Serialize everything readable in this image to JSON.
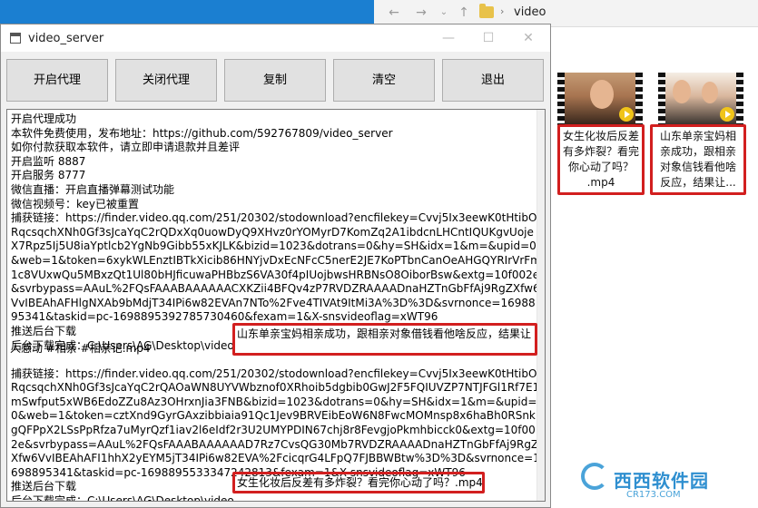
{
  "explorer": {
    "back_icon": "←",
    "forward_icon": "→",
    "dropdown_icon": "⌄",
    "up_icon": "↑",
    "path_separator": "›",
    "path": "video"
  },
  "thumbnails": [
    {
      "icon": "video-thumbnail-icon"
    },
    {
      "icon": "video-thumbnail-icon"
    }
  ],
  "files": [
    {
      "lines": [
        "女生化妆后反差",
        "有多炸裂？看完",
        "你心动了吗？",
        ".mp4"
      ]
    },
    {
      "lines": [
        "山东单亲宝妈相",
        "亲成功，跟相亲",
        "对象信钱看他啥",
        "反应，结果让..."
      ]
    }
  ],
  "window": {
    "title": "video_server",
    "minimize": "—",
    "maximize": "☐",
    "close": "✕"
  },
  "toolbar": {
    "start_proxy": "开启代理",
    "stop_proxy": "关闭代理",
    "copy": "复制",
    "clear": "清空",
    "exit": "退出"
  },
  "log": {
    "text": "开启代理成功\n本软件免费使用，发布地址：https://github.com/592767809/video_server\n如你付款获取本软件，请立即申请退款并且差评\n开启监听 8887\n开启服务 8777\n微信直播：开启直播弹幕测试功能\n微信视频号：key已被重置\n捕获链接：https://finder.video.qq.com/251/20302/stodownload?encfilekey=Cvvj5Ix3eewK0tHtibORqcsqchXNh0Gf3sJcaYqC2rQDxXq0uowDyQ9XHvz0rYOMyrD7KomZq2A1ibdcnLHCntIQUKgvUojeX7Rpz5Ij5U8iaYptlcb2YgNb9Gibb55xKJLK&bizid=1023&dotrans=0&hy=SH&idx=1&m=&upid=0&web=1&token=6xykWLEnztIBTkXicib86HNYjvDxEcNFcC5nerE2JE7KoPTbnCanOeAHGQYRIrVrFm1c8VUxwQu5MBxzQt1Ul80bHJficuwaPHBbzS6VA30f4pIUojbwsHRBNsO8OiborBsw&extg=10f002e&svrbypass=AAuL%2FQsFAAABAAAAAACXKZii4BFQv4zP7RVDZRAAAADnaHZTnGbFfAj9RgZXfw6VvIBEAhAFHlgNXAb9bMdjT34IPi6w82EVAn7NTo%2Fve4TIVAt9ItMi3A%3D%3D&svrnonce=1698895341&taskid=pc-1698895392785730460&fexam=1&X-snsvideoflag=xWT96\n推送后台下载\n后台下载完成：C:\\Users\\AG\\Desktop\\video\n\n捕获链接：https://finder.video.qq.com/251/20302/stodownload?encfilekey=Cvvj5Ix3eewK0tHtibORqcsqchXNh0Gf3sJcaYqC2rQAOaWN8UYVWbznof0XRhoib5dgbib0GwJ2F5FQIUVZP7NTJFGl1Rf7E1mSwfput5xWB6EdoZZu8Az3OHrxnJia3FNB&bizid=1023&dotrans=0&hy=SH&idx=1&m=&upid=0&web=1&token=cztXnd9GyrGAxzibbiaia91Qc1Jev9BRVEibEoW6N8FwcMOMnsp8x6haBh0RSnkgQFPpX2LSsPpRfza7uMyrQzf1iav2l6eIdf2r3U2UMYPDIN67chj8r8FevgjoPkmhbicck0&extg=10f002e&svrbypass=AAuL%2FQsFAAABAAAAAAD7Rz7CvsQG30Mb7RVDZRAAAADnaHZTnGbFfAj9RgZXfw6VvIBEAhAFI1hhX2yEYM5jT34IPi6w82EVA%2FcicqrG4LFpQ7FJBBWBtw%3D%3D&svrnonce=1698895341&taskid=pc-1698895533347242813&fexam=1&X-snsvideoflag=xWT96\n推送后台下载\n后台下载完成：C:\\Users\\AG\\Desktop\\video"
  },
  "highlights": {
    "first_line1": "山东单亲宝妈相亲成功，跟相亲对象借钱看他啥反应，结果让",
    "first_line2": "人感动 #相亲 #相亲记.mp4",
    "second": "女生化妆后反差有多炸裂？看完你心动了吗？.mp4"
  },
  "watermark": {
    "text": "西西软件园",
    "url": "CR173.COM"
  }
}
